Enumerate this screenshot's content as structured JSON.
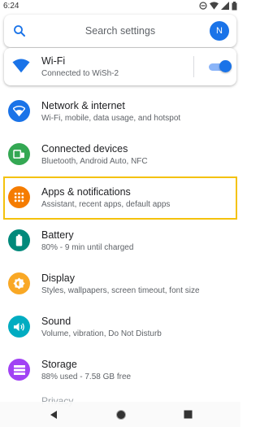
{
  "status_bar": {
    "time": "6:24"
  },
  "search": {
    "placeholder": "Search settings",
    "avatar_letter": "N"
  },
  "wifi": {
    "title": "Wi-Fi",
    "subtitle": "Connected to WiSh-2",
    "enabled": true
  },
  "items": [
    {
      "title": "Network & internet",
      "subtitle": "Wi-Fi, mobile, data usage, and hotspot",
      "color": "#1a73e8",
      "icon": "wifi-icon"
    },
    {
      "title": "Connected devices",
      "subtitle": "Bluetooth, Android Auto, NFC",
      "color": "#34a853",
      "icon": "devices-icon"
    },
    {
      "title": "Apps & notifications",
      "subtitle": "Assistant, recent apps, default apps",
      "color": "#f57c00",
      "icon": "apps-grid-icon"
    },
    {
      "title": "Battery",
      "subtitle": "80% - 9 min until charged",
      "color": "#00897b",
      "icon": "battery-icon"
    },
    {
      "title": "Display",
      "subtitle": "Styles, wallpapers, screen timeout, font size",
      "color": "#f9a825",
      "icon": "brightness-icon"
    },
    {
      "title": "Sound",
      "subtitle": "Volume, vibration, Do Not Disturb",
      "color": "#00acc1",
      "icon": "volume-icon"
    },
    {
      "title": "Storage",
      "subtitle": "88% used - 7.58 GB free",
      "color": "#a142f4",
      "icon": "storage-icon"
    }
  ],
  "peek_item": {
    "title": "Privacy"
  },
  "colors": {
    "accent": "#1a73e8",
    "highlight": "#f4c20d"
  }
}
